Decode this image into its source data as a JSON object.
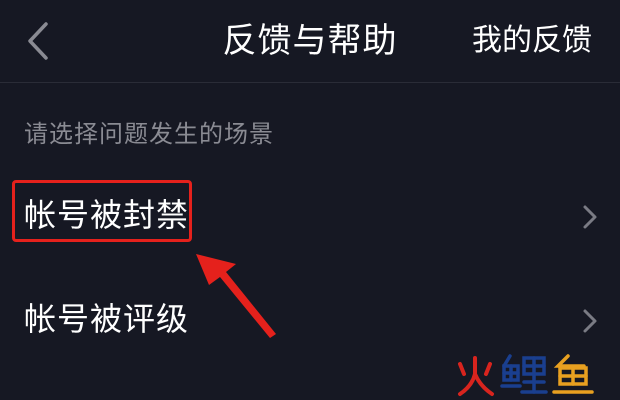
{
  "header": {
    "title": "反馈与帮助",
    "right_link": "我的反馈",
    "back_icon": "chevron-left-icon"
  },
  "section": {
    "label": "请选择问题发生的场景"
  },
  "items": [
    {
      "label": "帐号被封禁",
      "icon": "chevron-right-icon",
      "highlighted": true
    },
    {
      "label": "帐号被评级",
      "icon": "chevron-right-icon",
      "highlighted": false
    }
  ],
  "annotation": {
    "color": "#e5211c"
  },
  "watermark": {
    "text": "火鲤鱼",
    "colors": [
      "#d8241e",
      "#1a3f8f",
      "#e8a020"
    ]
  },
  "colors": {
    "background": "#161823",
    "text": "#ffffff",
    "muted": "#8a8b93",
    "chevron": "#7a7b84"
  }
}
